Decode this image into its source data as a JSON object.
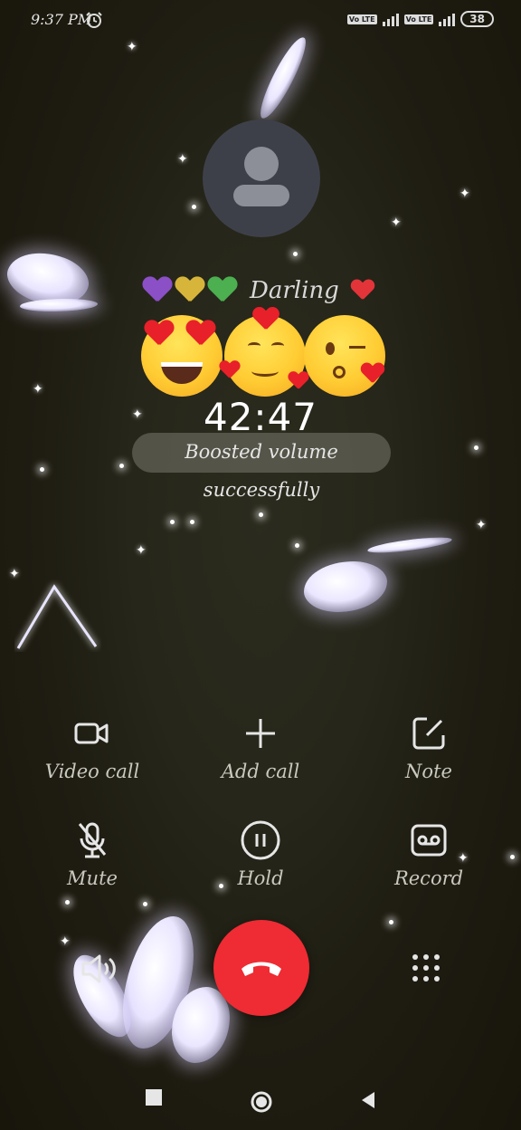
{
  "status_bar": {
    "time": "9:37 PM",
    "alarm_icon": "alarm-clock-icon",
    "sim1_badge": "Vo LTE",
    "sim2_badge": "Vo LTE",
    "battery": "38"
  },
  "call": {
    "contact_name": "Darling",
    "heart_colors": [
      "#8b4fc6",
      "#d6b53a",
      "#4caf50"
    ],
    "duration": "42:47",
    "toast": "Boosted volume successfully"
  },
  "controls": {
    "video_call": "Video call",
    "add_call": "Add call",
    "note": "Note",
    "mute": "Mute",
    "hold": "Hold",
    "record": "Record"
  },
  "bottom": {
    "speaker_icon": "speaker-icon",
    "end_call_icon": "end-call-icon",
    "dialpad_icon": "dialpad-icon",
    "end_call_color": "#ef2b33"
  },
  "navbar": {
    "recents_icon": "square-icon",
    "home_icon": "circle-icon",
    "back_icon": "triangle-back-icon"
  }
}
